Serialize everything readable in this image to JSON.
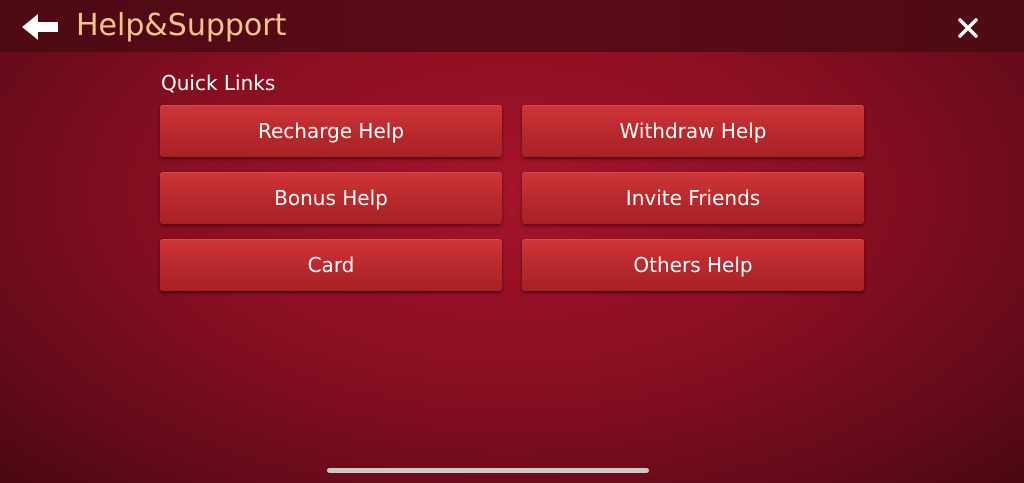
{
  "header": {
    "title": "Help&Support",
    "back_icon": "arrow-left-icon",
    "close_icon": "close-icon"
  },
  "quick_links": {
    "label": "Quick Links",
    "buttons": [
      {
        "label": "Recharge Help"
      },
      {
        "label": "Withdraw Help"
      },
      {
        "label": "Bonus Help"
      },
      {
        "label": "Invite Friends"
      },
      {
        "label": "Card"
      },
      {
        "label": "Others Help"
      }
    ]
  },
  "colors": {
    "title": "#f0c48a",
    "background": "#8a0f22",
    "button": "#b8282c"
  }
}
